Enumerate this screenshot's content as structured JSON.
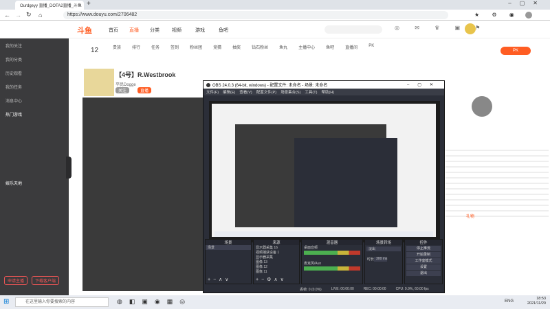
{
  "browser": {
    "tab_title": "Ourdgeyy 直播_DOTA2直播_斗鱼",
    "url": "https://www.douyu.com/2706482"
  },
  "site": {
    "logo": "斗鱼",
    "nav": [
      "首页",
      "直播",
      "分类",
      "视频",
      "游戏",
      "鱼吧"
    ]
  },
  "sidebar": {
    "items": [
      "我的关注",
      "我的分类",
      "历史观看",
      "我的任务",
      "消息中心"
    ],
    "section_a": "热门游戏",
    "section_b": "娱乐天地",
    "btn_a": "申请主播",
    "btn_b": "下载客户端"
  },
  "category": {
    "count": "12",
    "items": [
      "贵族",
      "排行",
      "任务",
      "签到",
      "粉丝团",
      "竞猜",
      "抽奖",
      "钻石粉丝",
      "鱼丸",
      "主播中心",
      "鱼吧",
      "直播间",
      "PK"
    ]
  },
  "room": {
    "title": "【4号】R.Westbrook",
    "streamer": "平民Dogge",
    "badge": "关注",
    "badge2": "直播",
    "chat_label": "礼物"
  },
  "obs": {
    "title": "OBS 24.0.3 (64-bit, windows) - 配置文件: 未命名 - 场景: 未命名",
    "menu": [
      "文件(F)",
      "编辑(E)",
      "查看(V)",
      "配置文件(P)",
      "场景集合(S)",
      "工具(T)",
      "帮助(H)"
    ],
    "docks": {
      "scenes": "场景",
      "sources": "来源",
      "mixer": "混音器",
      "transitions": "场景转场",
      "controls": "控件"
    },
    "scene_item": "场景",
    "source_items": [
      "显示器采集 16",
      "视频捕获设备 1",
      "显示器采集",
      "图像 13",
      "图像 12",
      "图像 11"
    ],
    "mixer_items": [
      "桌面音频",
      "麦克风/Aux"
    ],
    "transition": "淡出",
    "duration_label": "时长",
    "duration": "300 ms",
    "controls_buttons": [
      "停止推流",
      "开始录制",
      "工作室模式",
      "设置",
      "退出"
    ],
    "status": [
      "丢帧: 0 (0.0%)",
      "LIVE: 00:00:00",
      "REC: 00:00:00",
      "CPU: 9.9%, 60.00 fps"
    ]
  },
  "taskbar": {
    "search_placeholder": "在这里输入你要搜索的内容",
    "time": "18:53",
    "date": "2021/11/20",
    "lang": "ENG"
  },
  "colors": {
    "brand": "#ff5d23",
    "obs_bg": "#2b2e38"
  }
}
